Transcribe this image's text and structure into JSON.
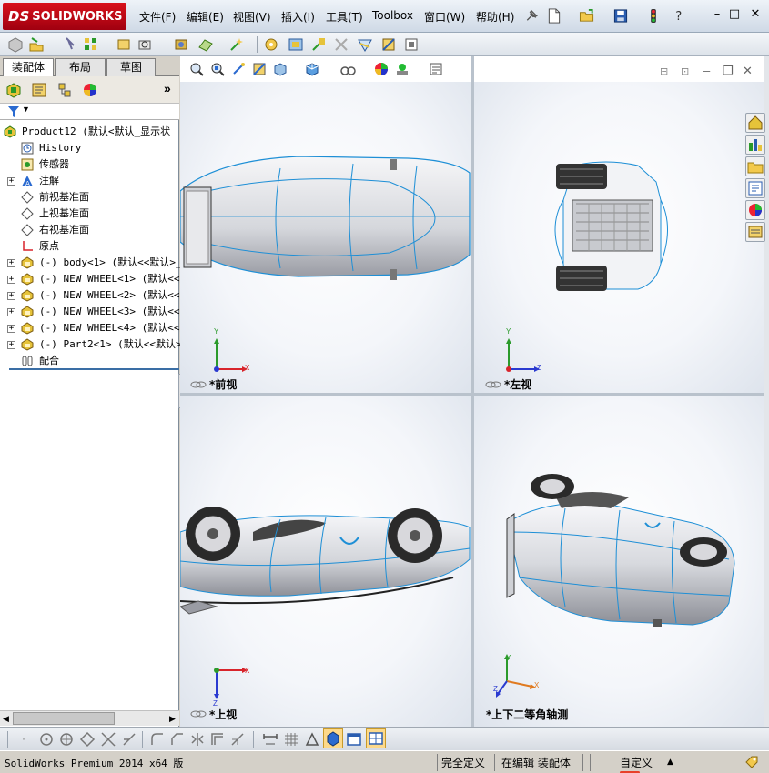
{
  "app": {
    "brand": "SOLIDWORKS",
    "brand_prefix": "DS"
  },
  "menu": [
    "文件(F)",
    "编辑(E)",
    "视图(V)",
    "插入(I)",
    "工具(T)",
    "Toolbox",
    "窗口(W)",
    "帮助(H)"
  ],
  "panel_tabs": [
    "装配体",
    "布局",
    "草图"
  ],
  "tree": {
    "root": "Product12  (默认<默认_显示状",
    "items": [
      {
        "label": "History",
        "icon": "history-icon",
        "expandable": false
      },
      {
        "label": "传感器",
        "icon": "sensor-icon",
        "expandable": false
      },
      {
        "label": "注解",
        "icon": "annotation-icon",
        "expandable": true
      },
      {
        "label": "前视基准面",
        "icon": "plane-icon",
        "expandable": false
      },
      {
        "label": "上视基准面",
        "icon": "plane-icon",
        "expandable": false
      },
      {
        "label": "右视基准面",
        "icon": "plane-icon",
        "expandable": false
      },
      {
        "label": "原点",
        "icon": "origin-icon",
        "expandable": false
      },
      {
        "label": "(-) body<1> (默认<<默认>_显",
        "icon": "part-icon",
        "expandable": true
      },
      {
        "label": "(-) NEW WHEEL<1> (默认<<默",
        "icon": "part-icon",
        "expandable": true
      },
      {
        "label": "(-) NEW WHEEL<2> (默认<<默",
        "icon": "part-icon",
        "expandable": true
      },
      {
        "label": "(-) NEW WHEEL<3> (默认<<默",
        "icon": "part-icon",
        "expandable": true
      },
      {
        "label": "(-) NEW WHEEL<4> (默认<<默",
        "icon": "part-icon",
        "expandable": true
      },
      {
        "label": "(-) Part2<1> (默认<<默认>_",
        "icon": "part-icon",
        "expandable": true
      },
      {
        "label": "配合",
        "icon": "mates-icon",
        "expandable": false
      }
    ]
  },
  "viewports": {
    "front": "*前视",
    "left": "*左视",
    "top": "*上视",
    "iso": "*上下二等角轴测"
  },
  "axes": {
    "x": "X",
    "y": "Y",
    "z": "Z"
  },
  "status": {
    "version": "SolidWorks Premium 2014 x64 版",
    "definition": "完全定义",
    "editing": "在编辑 装配体",
    "custom": "自定义"
  },
  "colors": {
    "accent_blue": "#1f5fb3",
    "edge_blue": "#1e8fd6",
    "brand_red": "#c8101a"
  }
}
